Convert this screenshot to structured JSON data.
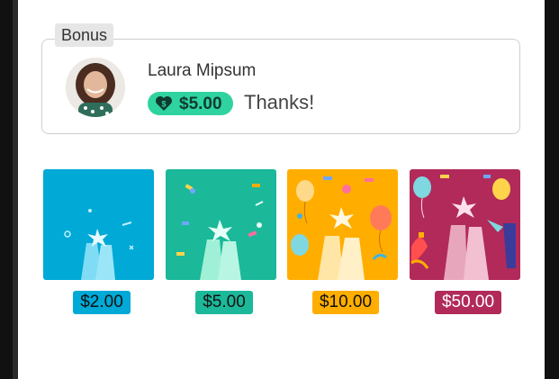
{
  "bonus": {
    "label": "Bonus",
    "user_name": "Laura Mipsum",
    "amount": "$5.00",
    "message": "Thanks!"
  },
  "tip_options": [
    {
      "price": "$2.00",
      "color": "#00a9d6"
    },
    {
      "price": "$5.00",
      "color": "#1bb89a"
    },
    {
      "price": "$10.00",
      "color": "#ffae00"
    },
    {
      "price": "$50.00",
      "color": "#b12a5a"
    }
  ],
  "colors": {
    "accent_green": "#2fd3a0",
    "card_border": "#cfcfcf"
  }
}
